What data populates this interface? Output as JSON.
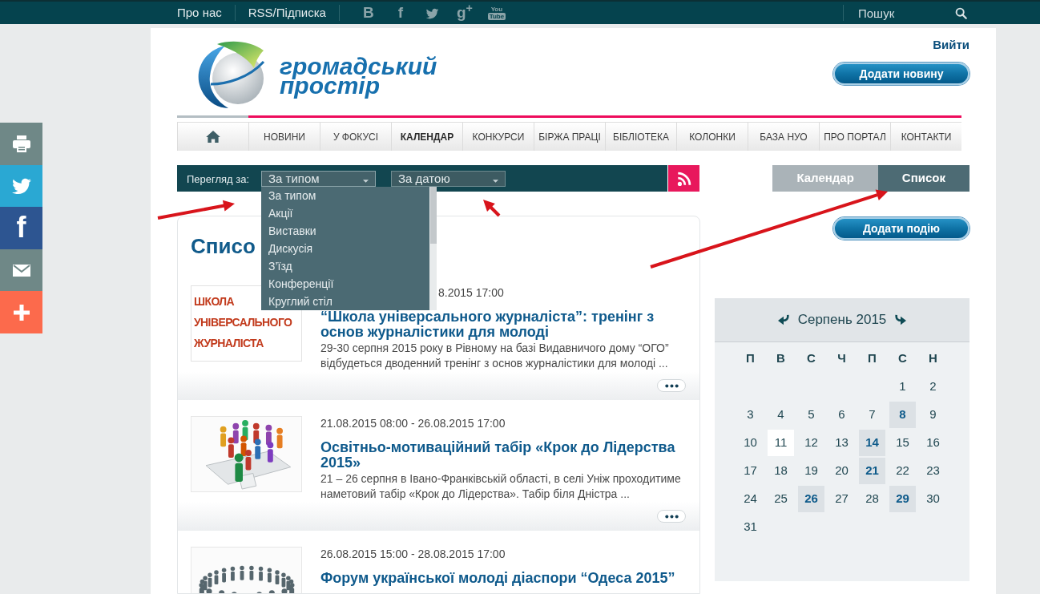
{
  "top_bar": {
    "links": [
      {
        "label": "Про нас"
      },
      {
        "label": "RSS/Підписка"
      }
    ],
    "social": [
      {
        "kind": "glyph",
        "label": "В"
      },
      {
        "kind": "glyph",
        "label": "f"
      },
      {
        "kind": "bird"
      },
      {
        "kind": "glyph",
        "label": "g$^{+}$"
      },
      {
        "kind": "tube",
        "label": "You",
        "badge": "Tube"
      }
    ],
    "search": {
      "placeholder": "Пошук"
    }
  },
  "side_share": [
    {
      "kind": "print"
    },
    {
      "kind": "bird"
    },
    {
      "kind": "glyph",
      "label": "f"
    },
    {
      "kind": "mail"
    },
    {
      "kind": "plus"
    }
  ],
  "header": {
    "logo": {
      "lines": [
        "громадський",
        "простір"
      ]
    },
    "logout_link": "Вийти",
    "add_news_button": "Додати новину"
  },
  "nav": [
    {
      "kind": "home",
      "selected": false
    },
    {
      "kind": "text",
      "label": "НОВИНИ",
      "selected": false
    },
    {
      "kind": "text",
      "label": "У ФОКУСІ",
      "selected": false
    },
    {
      "kind": "text",
      "label": "КАЛЕНДАР",
      "selected": true
    },
    {
      "kind": "text",
      "label": "КОНКУРСИ",
      "selected": false
    },
    {
      "kind": "text",
      "label": "БІРЖА ПРАЦІ",
      "selected": false
    },
    {
      "kind": "text",
      "label": "БІБЛІОТЕКА",
      "selected": false
    },
    {
      "kind": "text",
      "label": "КОЛОНКИ",
      "selected": false
    },
    {
      "kind": "text",
      "label": "БАЗА НУО",
      "selected": false
    },
    {
      "kind": "text",
      "label": "ПРО ПОРТАЛ",
      "selected": false
    },
    {
      "kind": "text",
      "label": "КОНТАКТИ",
      "selected": false
    }
  ],
  "filter_bar": {
    "label": "Перегляд за:",
    "selects": [
      {
        "value": "За типом",
        "open": true,
        "options": [
          "За типом",
          "Акції",
          "Виставки",
          "Дискусія",
          "З’їзд",
          "Конференції",
          "Круглий стіл"
        ]
      },
      {
        "value": "За датою",
        "open": false
      }
    ]
  },
  "content": {
    "heading": "Списо",
    "events": [
      {
        "image": {
          "kind": "poster",
          "lines": [
            "ШКОЛА",
            "УНІВЕРСАЛЬНОГО",
            "ЖУРНАЛІСТА"
          ]
        },
        "date": "8.2015 17:00",
        "title": "“Школа універсального журналіста”: тренінг з основ журналістики для молоді",
        "description": "29-30 серпня 2015 року в Рівному на базі Видавничого дому “ОГО” відбудеться дводенний тренінг з основ журналістики для молоді ..."
      },
      {
        "image": {
          "kind": "puzzle"
        },
        "date": "21.08.2015 08:00 - 26.08.2015 17:00",
        "title": "Освітньо-мотиваційний табір «Крок до Лідерства 2015»",
        "description": "21 – 26 серпня в Івано-Франківській області, в селі Уніж проходитиме наметовий табір «Крок до Лідерства». Табір біля Дністра ..."
      },
      {
        "image": {
          "kind": "ring"
        },
        "date": "26.08.2015 15:00 - 28.08.2015 17:00",
        "title": "Форум української молоді діаспори “Одеса 2015”"
      }
    ]
  },
  "view_tabs": [
    {
      "label": "Календар",
      "selected": false
    },
    {
      "label": "Список",
      "selected": true
    }
  ],
  "add_event_button": "Додати подію",
  "calendar": {
    "month": "Серпень 2015",
    "weekdays": [
      "П",
      "В",
      "С",
      "Ч",
      "П",
      "С",
      "Н"
    ],
    "weeks": [
      [
        {
          "day": "1",
          "event": false,
          "today": false
        },
        {
          "day": "2",
          "event": false,
          "today": false
        }
      ],
      [
        {
          "day": "3",
          "event": false,
          "today": false
        },
        {
          "day": "4",
          "event": false,
          "today": false
        },
        {
          "day": "5",
          "event": false,
          "today": false
        },
        {
          "day": "6",
          "event": false,
          "today": false
        },
        {
          "day": "7",
          "event": false,
          "today": false
        },
        {
          "day": "8",
          "event": true,
          "today": false
        },
        {
          "day": "9",
          "event": false,
          "today": false
        }
      ],
      [
        {
          "day": "10",
          "event": false,
          "today": false
        },
        {
          "day": "11",
          "event": false,
          "today": true
        },
        {
          "day": "12",
          "event": false,
          "today": false
        },
        {
          "day": "13",
          "event": false,
          "today": false
        },
        {
          "day": "14",
          "event": true,
          "today": false
        },
        {
          "day": "15",
          "event": false,
          "today": false
        },
        {
          "day": "16",
          "event": false,
          "today": false
        }
      ],
      [
        {
          "day": "17",
          "event": false,
          "today": false
        },
        {
          "day": "18",
          "event": false,
          "today": false
        },
        {
          "day": "19",
          "event": false,
          "today": false
        },
        {
          "day": "20",
          "event": false,
          "today": false
        },
        {
          "day": "21",
          "event": true,
          "today": false
        },
        {
          "day": "22",
          "event": false,
          "today": false
        },
        {
          "day": "23",
          "event": false,
          "today": false
        }
      ],
      [
        {
          "day": "24",
          "event": false,
          "today": false
        },
        {
          "day": "25",
          "event": false,
          "today": false
        },
        {
          "day": "26",
          "event": true,
          "today": false
        },
        {
          "day": "27",
          "event": false,
          "today": false
        },
        {
          "day": "28",
          "event": false,
          "today": false
        },
        {
          "day": "29",
          "event": true,
          "today": false
        },
        {
          "day": "30",
          "event": false,
          "today": false
        }
      ],
      [
        {
          "day": "31",
          "event": false,
          "today": false
        }
      ]
    ]
  }
}
